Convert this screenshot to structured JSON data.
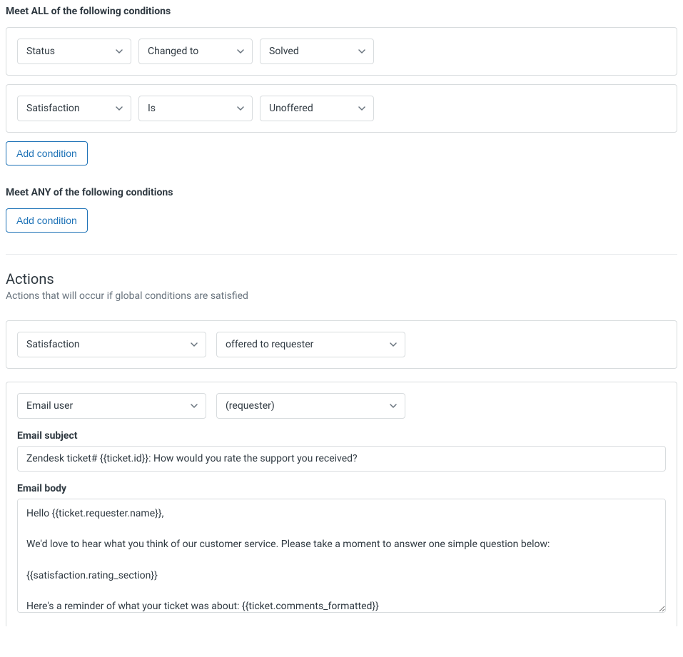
{
  "conditions": {
    "all_title": "Meet ALL of the following conditions",
    "any_title": "Meet ANY of the following conditions",
    "add_condition_label": "Add condition",
    "all": [
      {
        "field": "Status",
        "operator": "Changed to",
        "value": "Solved"
      },
      {
        "field": "Satisfaction",
        "operator": "Is",
        "value": "Unoffered"
      }
    ]
  },
  "actions": {
    "heading": "Actions",
    "subtext": "Actions that will occur if global conditions are satisfied",
    "items": [
      {
        "field": "Satisfaction",
        "value": "offered to requester"
      },
      {
        "field": "Email user",
        "value": "(requester)",
        "email_subject_label": "Email subject",
        "email_subject": "Zendesk ticket# {{ticket.id}}: How would you rate the support you received?",
        "email_body_label": "Email body",
        "email_body": "Hello {{ticket.requester.name}},\n\nWe'd love to hear what you think of our customer service. Please take a moment to answer one simple question below:\n\n{{satisfaction.rating_section}}\n\nHere's a reminder of what your ticket was about: {{ticket.comments_formatted}}"
      }
    ]
  }
}
